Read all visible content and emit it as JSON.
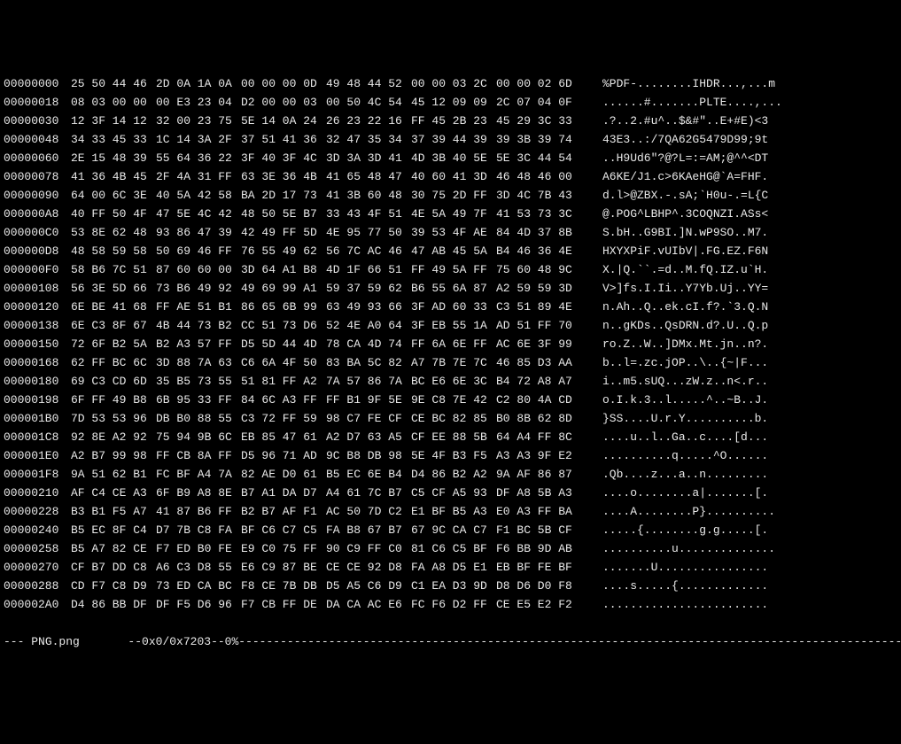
{
  "rows": [
    {
      "offset": "00000000",
      "hex": [
        "25 50 44 46",
        "2D 0A 1A 0A",
        "00 00 00 0D",
        "49 48 44 52",
        "00 00 03 2C",
        "00 00 02 6D"
      ],
      "ascii": "%PDF-........IHDR...,...m"
    },
    {
      "offset": "00000018",
      "hex": [
        "08 03 00 00",
        "00 E3 23 04",
        "D2 00 00 03",
        "00 50 4C 54",
        "45 12 09 09",
        "2C 07 04 0F"
      ],
      "ascii": "......#.......PLTE....,..."
    },
    {
      "offset": "00000030",
      "hex": [
        "12 3F 14 12",
        "32 00 23 75",
        "5E 14 0A 24",
        "26 23 22 16",
        "FF 45 2B 23",
        "45 29 3C 33"
      ],
      "ascii": ".?..2.#u^..$&#\"..E+#E)<3"
    },
    {
      "offset": "00000048",
      "hex": [
        "34 33 45 33",
        "1C 14 3A 2F",
        "37 51 41 36",
        "32 47 35 34",
        "37 39 44 39",
        "39 3B 39 74"
      ],
      "ascii": "43E3..:/7QA62G5479D99;9t"
    },
    {
      "offset": "00000060",
      "hex": [
        "2E 15 48 39",
        "55 64 36 22",
        "3F 40 3F 4C",
        "3D 3A 3D 41",
        "4D 3B 40 5E",
        "5E 3C 44 54"
      ],
      "ascii": "..H9Ud6\"?@?L=:=AM;@^^<DT"
    },
    {
      "offset": "00000078",
      "hex": [
        "41 36 4B 45",
        "2F 4A 31 FF",
        "63 3E 36 4B",
        "41 65 48 47",
        "40 60 41 3D",
        "46 48 46 00"
      ],
      "ascii": "A6KE/J1.c>6KAeHG@`A=FHF."
    },
    {
      "offset": "00000090",
      "hex": [
        "64 00 6C 3E",
        "40 5A 42 58",
        "BA 2D 17 73",
        "41 3B 60 48",
        "30 75 2D FF",
        "3D 4C 7B 43"
      ],
      "ascii": "d.l>@ZBX.-.sA;`H0u-.=L{C"
    },
    {
      "offset": "000000A8",
      "hex": [
        "40 FF 50 4F",
        "47 5E 4C 42",
        "48 50 5E B7",
        "33 43 4F 51",
        "4E 5A 49 7F",
        "41 53 73 3C"
      ],
      "ascii": "@.POG^LBHP^.3COQNZI.ASs<"
    },
    {
      "offset": "000000C0",
      "hex": [
        "53 8E 62 48",
        "93 86 47 39",
        "42 49 FF 5D",
        "4E 95 77 50",
        "39 53 4F AE",
        "84 4D 37 8B"
      ],
      "ascii": "S.bH..G9BI.]N.wP9SO..M7."
    },
    {
      "offset": "000000D8",
      "hex": [
        "48 58 59 58",
        "50 69 46 FF",
        "76 55 49 62",
        "56 7C AC 46",
        "47 AB 45 5A",
        "B4 46 36 4E"
      ],
      "ascii": "HXYXPiF.vUIbV|.FG.EZ.F6N"
    },
    {
      "offset": "000000F0",
      "hex": [
        "58 B6 7C 51",
        "87 60 60 00",
        "3D 64 A1 B8",
        "4D 1F 66 51",
        "FF 49 5A FF",
        "75 60 48 9C"
      ],
      "ascii": "X.|Q.``.=d..M.fQ.IZ.u`H."
    },
    {
      "offset": "00000108",
      "hex": [
        "56 3E 5D 66",
        "73 B6 49 92",
        "49 69 99 A1",
        "59 37 59 62",
        "B6 55 6A 87",
        "A2 59 59 3D"
      ],
      "ascii": "V>]fs.I.Ii..Y7Yb.Uj..YY="
    },
    {
      "offset": "00000120",
      "hex": [
        "6E BE 41 68",
        "FF AE 51 B1",
        "86 65 6B 99",
        "63 49 93 66",
        "3F AD 60 33",
        "C3 51 89 4E"
      ],
      "ascii": "n.Ah..Q..ek.cI.f?.`3.Q.N"
    },
    {
      "offset": "00000138",
      "hex": [
        "6E C3 8F 67",
        "4B 44 73 B2",
        "CC 51 73 D6",
        "52 4E A0 64",
        "3F EB 55 1A",
        "AD 51 FF 70"
      ],
      "ascii": "n..gKDs..QsDRN.d?.U..Q.p"
    },
    {
      "offset": "00000150",
      "hex": [
        "72 6F B2 5A",
        "B2 A3 57 FF",
        "D5 5D 44 4D",
        "78 CA 4D 74",
        "FF 6A 6E FF",
        "AC 6E 3F 99"
      ],
      "ascii": "ro.Z..W..]DMx.Mt.jn..n?."
    },
    {
      "offset": "00000168",
      "hex": [
        "62 FF BC 6C",
        "3D 88 7A 63",
        "C6 6A 4F 50",
        "83 BA 5C 82",
        "A7 7B 7E 7C",
        "46 85 D3 AA"
      ],
      "ascii": "b..l=.zc.jOP..\\..{~|F..."
    },
    {
      "offset": "00000180",
      "hex": [
        "69 C3 CD 6D",
        "35 B5 73 55",
        "51 81 FF A2",
        "7A 57 86 7A",
        "BC E6 6E 3C",
        "B4 72 A8 A7"
      ],
      "ascii": "i..m5.sUQ...zW.z..n<.r.."
    },
    {
      "offset": "00000198",
      "hex": [
        "6F FF 49 B8",
        "6B 95 33 FF",
        "84 6C A3 FF",
        "FF B1 9F 5E",
        "9E C8 7E 42",
        "C2 80 4A CD"
      ],
      "ascii": "o.I.k.3..l.....^..~B..J."
    },
    {
      "offset": "000001B0",
      "hex": [
        "7D 53 53 96",
        "DB B0 88 55",
        "C3 72 FF 59",
        "98 C7 FE CF",
        "CE BC 82 85",
        "B0 8B 62 8D"
      ],
      "ascii": "}SS....U.r.Y..........b."
    },
    {
      "offset": "000001C8",
      "hex": [
        "92 8E A2 92",
        "75 94 9B 6C",
        "EB 85 47 61",
        "A2 D7 63 A5",
        "CF EE 88 5B",
        "64 A4 FF 8C"
      ],
      "ascii": "....u..l..Ga..c....[d..."
    },
    {
      "offset": "000001E0",
      "hex": [
        "A2 B7 99 98",
        "FF CB 8A FF",
        "D5 96 71 AD",
        "9C B8 DB 98",
        "5E 4F B3 F5",
        "A3 A3 9F E2"
      ],
      "ascii": "..........q.....^O......"
    },
    {
      "offset": "000001F8",
      "hex": [
        "9A 51 62 B1",
        "FC BF A4 7A",
        "82 AE D0 61",
        "B5 EC 6E B4",
        "D4 86 B2 A2",
        "9A AF 86 87"
      ],
      "ascii": ".Qb....z...a..n........."
    },
    {
      "offset": "00000210",
      "hex": [
        "AF C4 CE A3",
        "6F B9 A8 8E",
        "B7 A1 DA D7",
        "A4 61 7C B7",
        "C5 CF A5 93",
        "DF A8 5B A3"
      ],
      "ascii": "....o........a|.......[."
    },
    {
      "offset": "00000228",
      "hex": [
        "B3 B1 F5 A7",
        "41 87 B6 FF",
        "B2 B7 AF F1",
        "AC 50 7D C2",
        "E1 BF B5 A3",
        "E0 A3 FF BA"
      ],
      "ascii": "....A........P}.........."
    },
    {
      "offset": "00000240",
      "hex": [
        "B5 EC 8F C4",
        "D7 7B C8 FA",
        "BF C6 C7 C5",
        "FA B8 67 B7",
        "67 9C CA C7",
        "F1 BC 5B CF"
      ],
      "ascii": ".....{........g.g.....[."
    },
    {
      "offset": "00000258",
      "hex": [
        "B5 A7 82 CE",
        "F7 ED B0 FE",
        "E9 C0 75 FF",
        "90 C9 FF C0",
        "81 C6 C5 BF",
        "F6 BB 9D AB"
      ],
      "ascii": "..........u.............."
    },
    {
      "offset": "00000270",
      "hex": [
        "CF B7 DD C8",
        "A6 C3 D8 55",
        "E6 C9 87 BE",
        "CE CE 92 D8",
        "FA A8 D5 E1",
        "EB BF FE BF"
      ],
      "ascii": ".......U................"
    },
    {
      "offset": "00000288",
      "hex": [
        "CD F7 C8 D9",
        "73 ED CA BC",
        "F8 CE 7B DB",
        "D5 A5 C6 D9",
        "C1 EA D3 9D",
        "D8 D6 D0 F8"
      ],
      "ascii": "....s.....{............."
    },
    {
      "offset": "000002A0",
      "hex": [
        "D4 86 BB DF",
        "DF F5 D6 96",
        "F7 CB FF DE",
        "DA CA AC E6",
        "FC F6 D2 FF",
        "CE E5 E2 F2"
      ],
      "ascii": "........................"
    }
  ],
  "status": {
    "filename": "PNG.png",
    "position": "0x0/0x7203",
    "percent": "0%"
  }
}
